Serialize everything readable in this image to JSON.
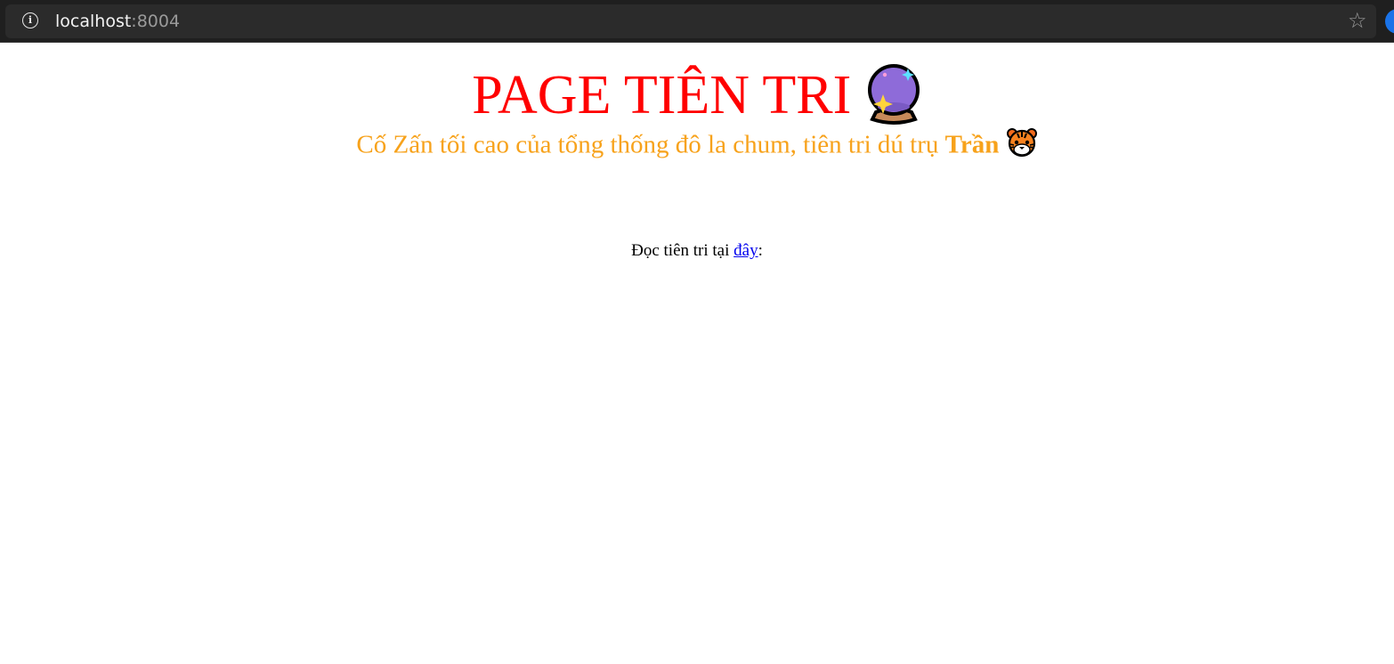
{
  "browser": {
    "url_host": "localhost",
    "url_port": ":8004"
  },
  "header": {
    "title": "PAGE TIÊN TRI",
    "title_icon": "crystal-ball-icon",
    "subtitle_text": "Cố Zấn tối cao của tổng thống đô la chum, tiên tri dú trụ ",
    "subtitle_bold": "Trần",
    "subtitle_icon": "tiger-face-icon"
  },
  "main": {
    "read_prefix": "Đọc tiên tri tại ",
    "read_link": "đây",
    "read_suffix": ":"
  },
  "colors": {
    "title": "#ff0000",
    "subtitle": "#f7a21b",
    "link": "#0000ee",
    "browser_bar": "#1f1f1f"
  }
}
